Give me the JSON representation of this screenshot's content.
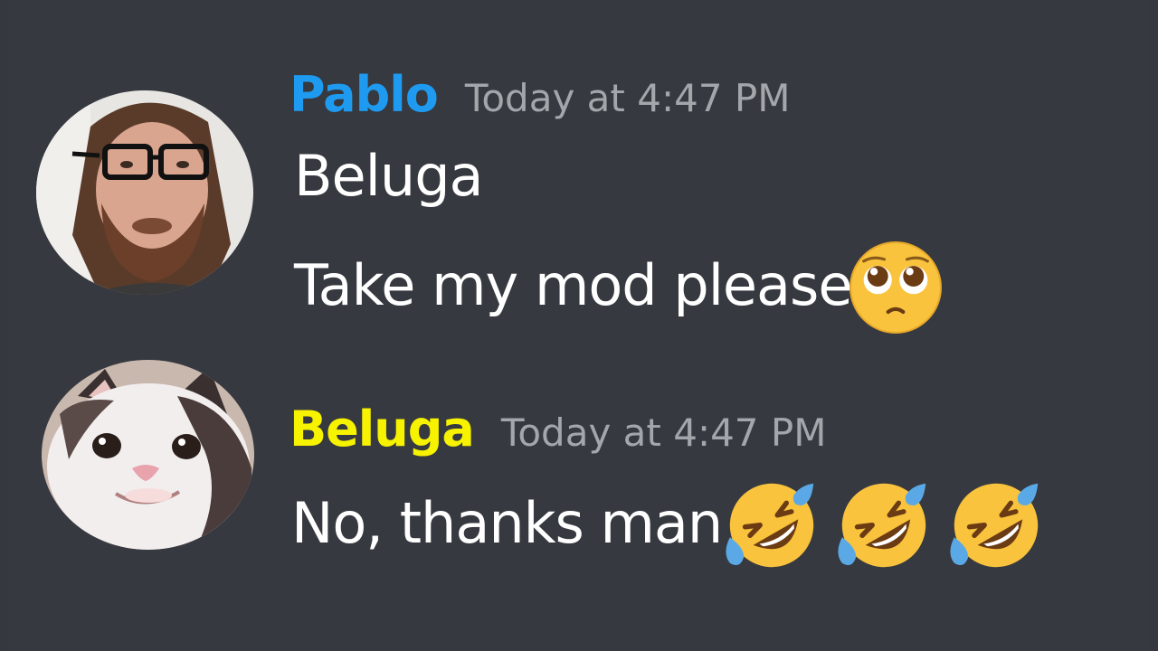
{
  "messages": [
    {
      "username": "Pablo",
      "username_color": "#1e9bf0",
      "timestamp": "Today at 4:47 PM",
      "lines": [
        "Beluga",
        "Take my mod please"
      ],
      "emoji": [
        "pleading-face-icon"
      ]
    },
    {
      "username": "Beluga",
      "username_color": "#f7f200",
      "timestamp": "Today at 4:47 PM",
      "lines": [
        "No, thanks man"
      ],
      "emoji": [
        "rofl-icon",
        "rofl-icon",
        "rofl-icon"
      ]
    }
  ],
  "theme": {
    "background": "#36393f",
    "timestamp_color": "#a3a6aa",
    "text_color": "#ffffff"
  }
}
